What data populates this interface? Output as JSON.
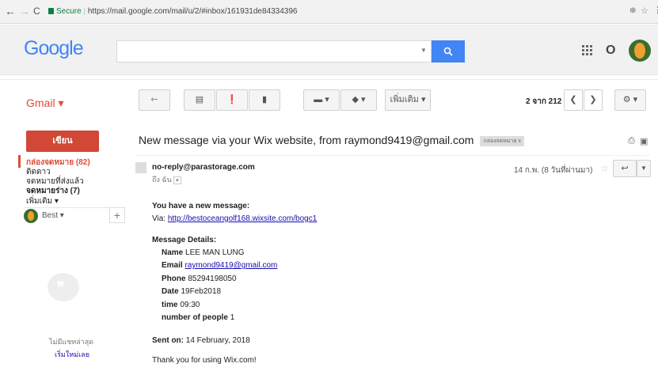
{
  "browser": {
    "secure_label": "Secure",
    "url": "https://mail.google.com/mail/u/2/#inbox/161931de84334396",
    "back": "←",
    "forward": "→",
    "reload": "C"
  },
  "header": {
    "logo": "Google",
    "search_placeholder": "",
    "avatar_letter": "O"
  },
  "gmail": {
    "label": "Gmail ▾"
  },
  "toolbar": {
    "more_label": "เพิ่มเติม ▾",
    "pager_text": "2 จาก 212"
  },
  "sidebar": {
    "compose": "เขียน",
    "items": [
      {
        "label": "กล่องจดหมาย (82)"
      },
      {
        "label": "ติดดาว"
      },
      {
        "label": "จดหมายที่ส่งแล้ว"
      },
      {
        "label": "จดหมายร่าง (7)"
      },
      {
        "label": "เพิ่มเติม ▾"
      }
    ],
    "hangout_user": "Best ▾",
    "plus": "+",
    "no_recent_chats": "ไม่มีแชทล่าสุด",
    "start_new": "เริ่มใหม่เลย"
  },
  "message": {
    "subject": "New message via your Wix website, from raymond9419@gmail.com",
    "label_chip": "กล่องจดหมาย   x",
    "sender": "no-reply@parastorage.com",
    "to": "ถึง ฉัน",
    "date": "14 ก.พ. (8 วันที่ผ่านมา)",
    "intro": "You have a new message:",
    "via_prefix": "Via: ",
    "via_link": "http://bestoceangolf168.wixsite.com/bogc1",
    "details_title": "Message Details:",
    "name_label": "Name",
    "name": "LEE MAN LUNG",
    "email_label": "Email",
    "email": "raymond9419@gmail.com",
    "phone_label": "Phone",
    "phone": "85294198050",
    "date_label": "Date",
    "date_value": "19Feb2018",
    "time_label": "time",
    "time_value": "09:30",
    "people_label": "number of people",
    "people": "1",
    "sent_label": "Sent on:",
    "sent_value": "14 February, 2018",
    "thanks": "Thank you for using Wix.com!"
  },
  "colors": {
    "accent_blue": "#4285f4",
    "compose_red": "#d14836",
    "gmail_red": "#dd4b39",
    "secure_green": "#0b8043"
  }
}
